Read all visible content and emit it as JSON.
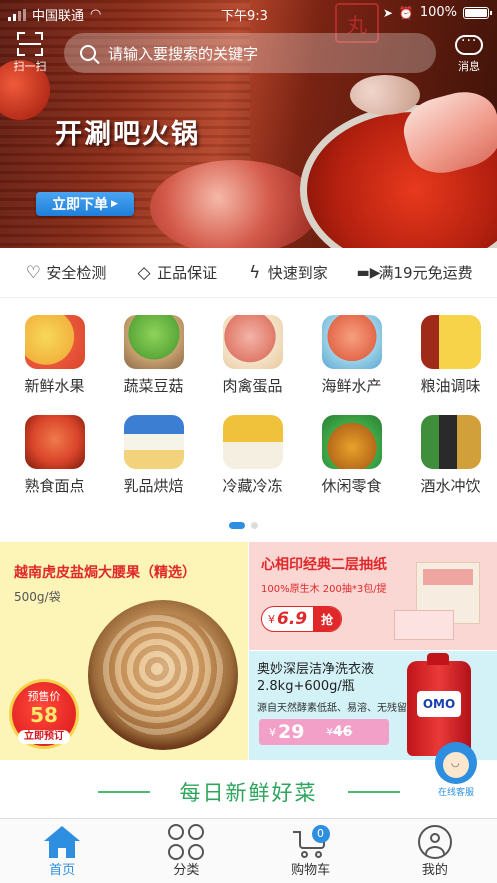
{
  "status_bar": {
    "carrier": "中国联通",
    "time": "下午9:3",
    "battery": "100%"
  },
  "header": {
    "scan_label": "扫一扫",
    "search_placeholder": "请输入要搜索的关键字",
    "message_label": "消息"
  },
  "banner": {
    "title": "开涮吧火锅",
    "order_button": "立即下单",
    "stamp_text": "丸"
  },
  "guarantees": [
    {
      "icon": "heart-icon",
      "label": "安全检测"
    },
    {
      "icon": "diamond-icon",
      "label": "正品保证"
    },
    {
      "icon": "lightning-icon",
      "label": "快速到家"
    },
    {
      "icon": "truck-icon",
      "label": "满19元免运费"
    }
  ],
  "categories": [
    {
      "label": "新鲜水果",
      "icon": "fruit-icon",
      "color": "#f2b33d"
    },
    {
      "label": "蔬菜豆菇",
      "icon": "vegetable-icon",
      "color": "#5aa83a"
    },
    {
      "label": "肉禽蛋品",
      "icon": "meat-icon",
      "color": "#e07a6a"
    },
    {
      "label": "海鲜水产",
      "icon": "seafood-icon",
      "color": "#e4694a"
    },
    {
      "label": "粮油调味",
      "icon": "oil-icon",
      "color": "#e9b422"
    },
    {
      "label": "熟食面点",
      "icon": "cooked-food-icon",
      "color": "#d9442a"
    },
    {
      "label": "乳品烘焙",
      "icon": "dairy-icon",
      "color": "#3c7fd2"
    },
    {
      "label": "冷藏冷冻",
      "icon": "frozen-icon",
      "color": "#f0c23c"
    },
    {
      "label": "休闲零食",
      "icon": "snack-icon",
      "color": "#e8a22a"
    },
    {
      "label": "酒水冲饮",
      "icon": "drink-icon",
      "color": "#3e8e3c"
    }
  ],
  "carousel": {
    "pages": 2,
    "active": 1
  },
  "promo": {
    "cashew": {
      "title": "越南虎皮盐焗大腰果（精选）",
      "spec": "500g/袋",
      "presale_label": "预售价",
      "presale_price": "58",
      "preorder_button": "立即预订"
    },
    "tissue": {
      "title": "心相印经典二层抽纸",
      "spec": "100%原生木 200抽*3包/提",
      "currency": "¥",
      "price": "6.9",
      "grab_button": "抢"
    },
    "detergent": {
      "title_line1": "奥妙深层洁净洗衣液",
      "title_line2": "2.8kg+600g/瓶",
      "spec": "源自天然酵素低舐、易溶、无残留",
      "currency": "¥",
      "price": "29",
      "old_currency": "¥",
      "old_price": "46",
      "brand": "OMO"
    }
  },
  "section": {
    "title": "每日新鲜好菜"
  },
  "service": {
    "label": "在线客服"
  },
  "tabbar": [
    {
      "label": "首页",
      "icon": "home-icon",
      "active": true
    },
    {
      "label": "分类",
      "icon": "category-icon",
      "active": false
    },
    {
      "label": "购物车",
      "icon": "cart-icon",
      "active": false,
      "badge": "0"
    },
    {
      "label": "我的",
      "icon": "profile-icon",
      "active": false
    }
  ],
  "colors": {
    "accent": "#2e8fe0",
    "promo_red": "#e0282a",
    "section_green": "#2ea55c"
  }
}
